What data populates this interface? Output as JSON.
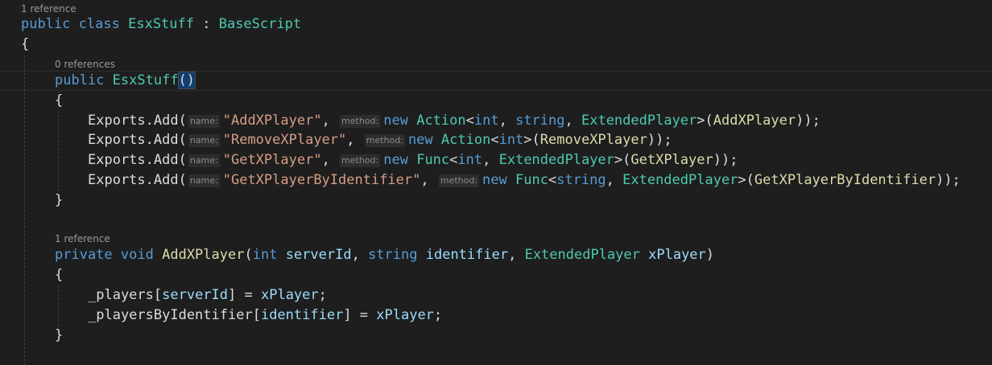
{
  "codelens": {
    "class_refs": "1 reference",
    "ctor_refs": "0 references",
    "method_refs": "1 reference"
  },
  "code": {
    "class_decl": {
      "kw_public": "public",
      "kw_class": "class",
      "class_name": "EsxStuff",
      "colon": " : ",
      "base_type": "BaseScript"
    },
    "class_open": "{",
    "ctor": {
      "kw_public": "public",
      "name": "EsxStuff",
      "parens": "()"
    },
    "ctor_open": "{",
    "exports": [
      {
        "prefix": "Exports.Add(",
        "name_hint": "name:",
        "name_value": "\"AddXPlayer\"",
        "sep": ", ",
        "method_hint": "method:",
        "kw_new": "new",
        "delegate": "Action",
        "type_args": [
          [
            "<",
            "int"
          ],
          [
            ", ",
            "string"
          ],
          [
            ", ",
            "ExtendedPlayer"
          ]
        ],
        "type_close": ">(",
        "target": "AddXPlayer",
        "suffix": "));"
      },
      {
        "prefix": "Exports.Add(",
        "name_hint": "name:",
        "name_value": "\"RemoveXPlayer\"",
        "sep": ", ",
        "method_hint": "method:",
        "kw_new": "new",
        "delegate": "Action",
        "type_args": [
          [
            "<",
            "int"
          ]
        ],
        "type_close": ">(",
        "target": "RemoveXPlayer",
        "suffix": "));"
      },
      {
        "prefix": "Exports.Add(",
        "name_hint": "name:",
        "name_value": "\"GetXPlayer\"",
        "sep": ", ",
        "method_hint": "method:",
        "kw_new": "new",
        "delegate": "Func",
        "type_args": [
          [
            "<",
            "int"
          ],
          [
            ", ",
            "ExtendedPlayer"
          ]
        ],
        "type_close": ">(",
        "target": "GetXPlayer",
        "suffix": "));"
      },
      {
        "prefix": "Exports.Add(",
        "name_hint": "name:",
        "name_value": "\"GetXPlayerByIdentifier\"",
        "sep": ", ",
        "method_hint": "method:",
        "kw_new": "new",
        "delegate": "Func",
        "type_args": [
          [
            "<",
            "string"
          ],
          [
            ", ",
            "ExtendedPlayer"
          ]
        ],
        "type_close": ">(",
        "target": "GetXPlayerByIdentifier",
        "suffix": "));"
      }
    ],
    "ctor_close": "}",
    "method_decl": {
      "kw_private": "private",
      "kw_void": "void",
      "name": "AddXPlayer",
      "open": "(",
      "kw_int": "int",
      "p1": "serverId",
      "comma1": ", ",
      "kw_string": "string",
      "p2": "identifier",
      "comma2": ", ",
      "type3": "ExtendedPlayer",
      "p3": "xPlayer",
      "close": ")"
    },
    "method_open": "{",
    "stmt1": {
      "field": "_players",
      "lb": "[",
      "idx": "serverId",
      "rb_eq": "] = ",
      "val": "xPlayer",
      "semi": ";"
    },
    "stmt2": {
      "field": "_playersByIdentifier",
      "lb": "[",
      "idx": "identifier",
      "rb_eq": "] = ",
      "val": "xPlayer",
      "semi": ";"
    },
    "method_close": "}"
  },
  "colors": {
    "background": "#1e1e1e",
    "keyword": "#569cd6",
    "type": "#4ec9b0",
    "method": "#dcdcaa",
    "parameter": "#9cdcfe",
    "string": "#d69d85",
    "text": "#dcdcdc",
    "codelens": "#999999"
  }
}
